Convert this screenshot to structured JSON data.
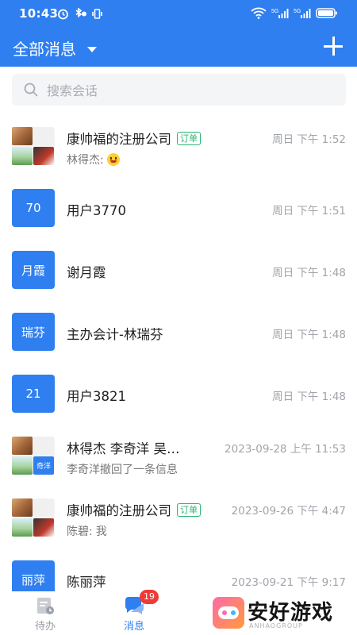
{
  "status_bar": {
    "time": "10:43",
    "left_icons": [
      "alarm-icon",
      "bluetooth-icon",
      "vibrate-icon"
    ],
    "right_icons": [
      "wifi-icon",
      "signal-5g-icon",
      "signal-5g-2-icon",
      "battery-icon"
    ],
    "signal_labels": [
      "5G",
      "5G"
    ]
  },
  "header": {
    "title": "全部消息",
    "caret_icon": "caret-down-icon",
    "add_icon": "plus-icon",
    "color": "#2f7ff0"
  },
  "search": {
    "placeholder": "搜索会话",
    "icon": "search-icon"
  },
  "conversations": [
    {
      "avatar": "group",
      "avatar_text": "",
      "name": "康帅福的注册公司",
      "tag": "订单",
      "preview_sender": "林得杰:",
      "preview_text": "",
      "preview_emoji": "grinning-emoji-icon",
      "time": "周日 下午 1:52"
    },
    {
      "avatar": "text",
      "avatar_text": "70",
      "name": "用户3770",
      "tag": "",
      "preview_sender": "",
      "preview_text": "",
      "time": "周日 下午 1:51"
    },
    {
      "avatar": "text",
      "avatar_text": "月霞",
      "name": "谢月霞",
      "tag": "",
      "preview_sender": "",
      "preview_text": "",
      "time": "周日 下午 1:48"
    },
    {
      "avatar": "text",
      "avatar_text": "瑞芬",
      "name": "主办会计-林瑞芬",
      "tag": "",
      "preview_sender": "",
      "preview_text": "",
      "time": "周日 下午 1:48"
    },
    {
      "avatar": "text",
      "avatar_text": "21",
      "name": "用户3821",
      "tag": "",
      "preview_sender": "",
      "preview_text": "",
      "time": "周日 下午 1:48"
    },
    {
      "avatar": "group",
      "avatar_text": "奇洋",
      "name": "林得杰 李奇洋 吴…",
      "tag": "",
      "preview_sender": "",
      "preview_text": "李奇洋撤回了一条信息",
      "time": "2023-09-28 上午 11:53"
    },
    {
      "avatar": "group",
      "avatar_text": "",
      "name": "康帅福的注册公司",
      "tag": "订单",
      "preview_sender": "陈碧:",
      "preview_text": "我",
      "time": "2023-09-26 下午 4:47"
    },
    {
      "avatar": "text",
      "avatar_text": "丽萍",
      "name": "陈丽萍",
      "tag": "",
      "preview_sender": "",
      "preview_text": "",
      "time": "2023-09-21 下午 9:17"
    }
  ],
  "tabbar": {
    "tabs": [
      {
        "label": "待办",
        "icon": "todo-icon",
        "active": false
      },
      {
        "label": "消息",
        "icon": "message-icon",
        "active": true,
        "badge": "19"
      }
    ]
  },
  "watermark": {
    "text": "安好游戏",
    "sub": "ANHAOGROUP",
    "icon": "game-controller-logo-icon"
  }
}
